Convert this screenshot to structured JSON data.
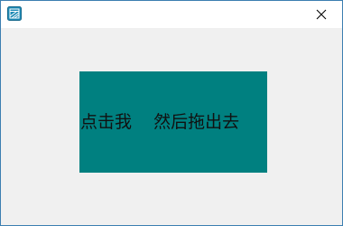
{
  "window": {
    "app_icon": "app-icon",
    "close_icon": "close-icon",
    "colors": {
      "border": "#3c7fb1",
      "titlebar": "#ffffff",
      "client": "#f0f0f0"
    }
  },
  "main": {
    "drag_box": {
      "text": "点击我    然后拖出去",
      "background": "#008080"
    }
  }
}
